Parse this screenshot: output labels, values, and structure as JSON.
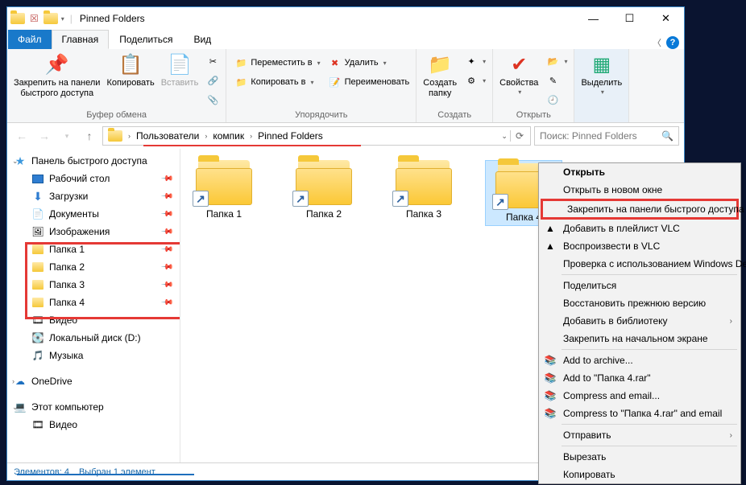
{
  "window": {
    "title": "Pinned Folders"
  },
  "tabs": {
    "file": "Файл",
    "home": "Главная",
    "share": "Поделиться",
    "view": "Вид"
  },
  "ribbon": {
    "pin_qa": "Закрепить на панели\nбыстрого доступа",
    "copy": "Копировать",
    "paste": "Вставить",
    "g_clipboard": "Буфер обмена",
    "move_to": "Переместить в",
    "copy_to": "Копировать в",
    "delete": "Удалить",
    "rename": "Переименовать",
    "g_organize": "Упорядочить",
    "new_folder": "Создать\nпапку",
    "g_new": "Создать",
    "properties": "Свойства",
    "g_open": "Открыть",
    "select": "Выделить"
  },
  "breadcrumb": {
    "s1": "Пользователи",
    "s2": "компик",
    "s3": "Pinned Folders"
  },
  "search": {
    "placeholder": "Поиск: Pinned Folders"
  },
  "nav": {
    "qa": "Панель быстрого доступа",
    "desktop": "Рабочий стол",
    "downloads": "Загрузки",
    "documents": "Документы",
    "pictures": "Изображения",
    "f1": "Папка 1",
    "f2": "Папка 2",
    "f3": "Папка 3",
    "f4": "Папка 4",
    "video": "Видео",
    "disk": "Локальный диск (D:)",
    "music": "Музыка",
    "onedrive": "OneDrive",
    "thispc": "Этот компьютер",
    "video2": "Видео"
  },
  "files": {
    "f1": "Папка 1",
    "f2": "Папка 2",
    "f3": "Папка 3",
    "f4": "Папка 4"
  },
  "status": {
    "count": "Элементов: 4",
    "sel": "Выбран 1 элемент"
  },
  "ctx": {
    "open": "Открыть",
    "open_new": "Открыть в новом окне",
    "pin_qa": "Закрепить на панели быстрого доступа",
    "vlc_add": "Добавить в плейлист VLC",
    "vlc_play": "Воспроизвести в VLC",
    "defender": "Проверка с использованием Windows Defe",
    "share": "Поделиться",
    "restore": "Восстановить прежнюю версию",
    "add_lib": "Добавить в библиотеку",
    "pin_start": "Закрепить на начальном экране",
    "rar1": "Add to archive...",
    "rar2": "Add to \"Папка 4.rar\"",
    "rar3": "Compress and email...",
    "rar4": "Compress to \"Папка 4.rar\" and email",
    "send": "Отправить",
    "cut": "Вырезать",
    "copy": "Копировать"
  }
}
